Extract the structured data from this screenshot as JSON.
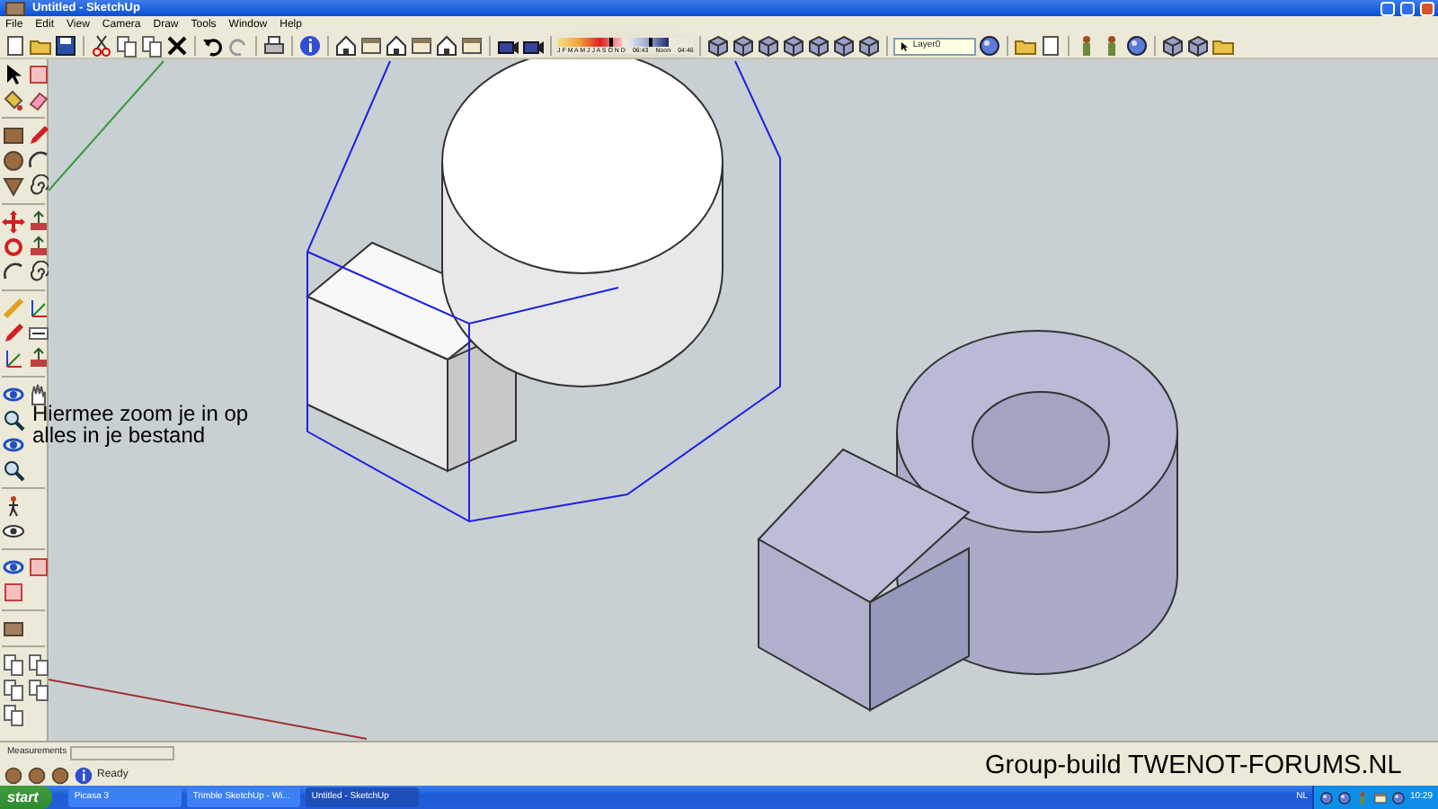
{
  "window": {
    "title": "Untitled - SketchUp"
  },
  "menu": [
    "File",
    "Edit",
    "View",
    "Camera",
    "Draw",
    "Tools",
    "Window",
    "Help"
  ],
  "shadow_settings": {
    "date_slider": {
      "level": 0.8
    },
    "time_slider": {
      "level": 0.5
    },
    "months": "J F M A M J J A S O N D",
    "time_start": "06:43",
    "time_mid": "Noon",
    "time_end": "04:46"
  },
  "layer_dropdown": {
    "value": "Layer0"
  },
  "annotation": "Hiermee zoom je in op alles in je bestand",
  "measurements": {
    "label": "Measurements"
  },
  "status": "Ready",
  "caption": "Group-build TWENOT-FORUMS.NL",
  "taskbar": {
    "start": "start",
    "buttons": [
      {
        "label": "Picasa 3",
        "selected": false
      },
      {
        "label": "Trimble SketchUp - Wi...",
        "selected": false
      },
      {
        "label": "Untitled - SketchUp",
        "selected": true
      }
    ],
    "language": "NL",
    "clock": "10:29"
  }
}
